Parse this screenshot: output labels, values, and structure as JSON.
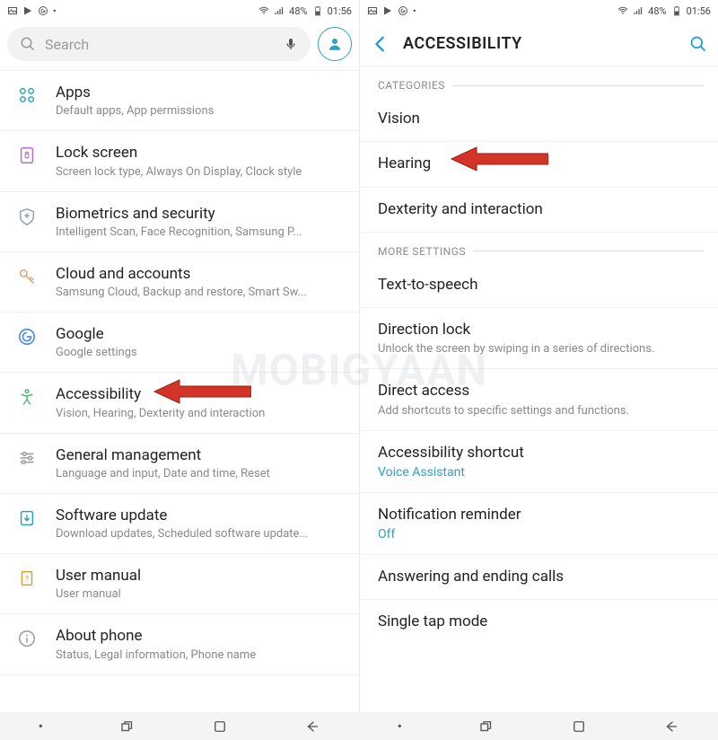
{
  "status": {
    "battery_text": "48%",
    "time": "01:56"
  },
  "left": {
    "search_placeholder": "Search",
    "items": [
      {
        "title": "Apps",
        "sub": "Default apps, App permissions"
      },
      {
        "title": "Lock screen",
        "sub": "Screen lock type, Always On Display, Clock style"
      },
      {
        "title": "Biometrics and security",
        "sub": "Intelligent Scan, Face Recognition, Samsung P..."
      },
      {
        "title": "Cloud and accounts",
        "sub": "Samsung Cloud, Backup and restore, Smart Sw..."
      },
      {
        "title": "Google",
        "sub": "Google settings"
      },
      {
        "title": "Accessibility",
        "sub": "Vision, Hearing, Dexterity and interaction"
      },
      {
        "title": "General management",
        "sub": "Language and input, Date and time, Reset"
      },
      {
        "title": "Software update",
        "sub": "Download updates, Scheduled software update..."
      },
      {
        "title": "User manual",
        "sub": "User manual"
      },
      {
        "title": "About phone",
        "sub": "Status, Legal information, Phone name"
      }
    ]
  },
  "right": {
    "header": "ACCESSIBILITY",
    "sections": {
      "categories_label": "CATEGORIES",
      "more_label": "MORE SETTINGS"
    },
    "categories": [
      {
        "title": "Vision"
      },
      {
        "title": "Hearing"
      },
      {
        "title": "Dexterity and interaction"
      }
    ],
    "more": [
      {
        "title": "Text-to-speech"
      },
      {
        "title": "Direction lock",
        "sub": "Unlock the screen by swiping in a series of directions."
      },
      {
        "title": "Direct access",
        "sub": "Add shortcuts to specific settings and functions."
      },
      {
        "title": "Accessibility shortcut",
        "accent": "Voice Assistant"
      },
      {
        "title": "Notification reminder",
        "accent": "Off"
      },
      {
        "title": "Answering and ending calls"
      },
      {
        "title": "Single tap mode"
      }
    ]
  },
  "watermark": "MOBIGYAAN"
}
